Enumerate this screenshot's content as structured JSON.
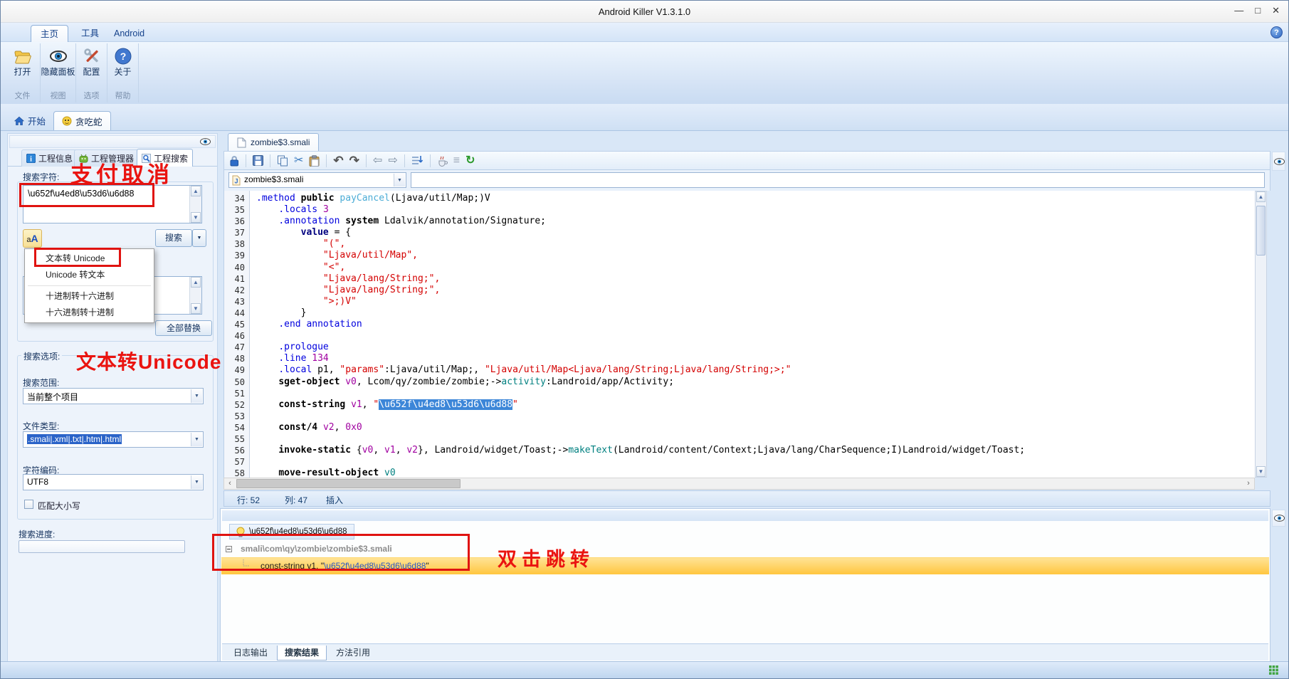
{
  "window": {
    "title": "Android Killer V1.3.1.0",
    "controls": {
      "minimize": "—",
      "maximize": "□",
      "close": "✕"
    },
    "help_label": "?"
  },
  "icons": {
    "dropdown": "▼",
    "up": "▲",
    "down": "▼",
    "left": "‹",
    "right": "›",
    "cut": "✂",
    "undo": "↶",
    "redo": "↷",
    "back": "⇦",
    "forward": "⇨",
    "lines": "≡",
    "refresh": "↻"
  },
  "ribbon": {
    "tabs": [
      {
        "label": "主页"
      },
      {
        "label": "工具"
      },
      {
        "label": "Android"
      }
    ],
    "buttons": [
      {
        "label": "打开",
        "group": "文件",
        "icon": "open-folder-icon"
      },
      {
        "label": "隐藏面板",
        "group": "视图",
        "icon": "eye-icon"
      },
      {
        "label": "配置",
        "group": "选项",
        "icon": "tools-icon"
      },
      {
        "label": "关于",
        "group": "帮助",
        "icon": "help-icon"
      }
    ]
  },
  "doc_tabs": [
    {
      "label": "开始"
    },
    {
      "label": "贪吃蛇"
    }
  ],
  "left_panel": {
    "tabs": [
      {
        "label": "工程信息"
      },
      {
        "label": "工程管理器"
      },
      {
        "label": "工程搜索"
      }
    ],
    "search_label": "搜索字符:",
    "search_value": "\\u652f\\u4ed8\\u53d6\\u6d88",
    "convert_icon": {
      "small": "a",
      "big": "A"
    },
    "search_button": "搜索",
    "menu": {
      "items": [
        "文本转 Unicode",
        "Unicode 转文本",
        "十进制转十六进制",
        "十六进制转十进制"
      ]
    },
    "replace_all_button": "全部替换",
    "options_label": "搜索选项:",
    "scope_label": "搜索范围:",
    "scope_value": "当前整个项目",
    "filetype_label": "文件类型:",
    "filetype_value": ".smali|.xml|.txt|.htm|.html",
    "encoding_label": "字符编码:",
    "encoding_value": "UTF8",
    "match_case_label": "匹配大小写",
    "progress_label": "搜索进度:"
  },
  "annotations": {
    "pay_cancel": "支付取消",
    "text_to_unicode": "文本转Unicode",
    "double_click_jump": "双击跳转"
  },
  "editor": {
    "tab_label": "zombie$3.smali",
    "file_combo_value": "zombie$3.smali",
    "status": {
      "line": "行: 52",
      "column": "列: 47",
      "mode": "插入"
    },
    "code_lines": [
      {
        "n": 34,
        "t": [
          [
            "kw",
            ".method "
          ],
          [
            "b",
            "public "
          ],
          [
            "mn",
            "payCancel"
          ],
          [
            "pl",
            "(Ljava/util/Map;)V"
          ]
        ]
      },
      {
        "n": 35,
        "t": [
          [
            "pl",
            "    "
          ],
          [
            "kw",
            ".locals "
          ],
          [
            "num",
            "3"
          ]
        ]
      },
      {
        "n": 36,
        "t": [
          [
            "pl",
            "    "
          ],
          [
            "kw",
            ".annotation "
          ],
          [
            "b",
            "system "
          ],
          [
            "pl",
            "Ldalvik/annotation/Signature;"
          ]
        ]
      },
      {
        "n": 37,
        "t": [
          [
            "pl",
            "        "
          ],
          [
            "bn",
            "value"
          ],
          [
            "pl",
            " = {"
          ]
        ]
      },
      {
        "n": 38,
        "t": [
          [
            "pl",
            "            "
          ],
          [
            "str",
            "\"(\","
          ]
        ]
      },
      {
        "n": 39,
        "t": [
          [
            "pl",
            "            "
          ],
          [
            "str",
            "\"Ljava/util/Map\","
          ]
        ]
      },
      {
        "n": 40,
        "t": [
          [
            "pl",
            "            "
          ],
          [
            "str",
            "\"<\","
          ]
        ]
      },
      {
        "n": 41,
        "t": [
          [
            "pl",
            "            "
          ],
          [
            "str",
            "\"Ljava/lang/String;\","
          ]
        ]
      },
      {
        "n": 42,
        "t": [
          [
            "pl",
            "            "
          ],
          [
            "str",
            "\"Ljava/lang/String;\","
          ]
        ]
      },
      {
        "n": 43,
        "t": [
          [
            "pl",
            "            "
          ],
          [
            "str",
            "\">;)V\""
          ]
        ]
      },
      {
        "n": 44,
        "t": [
          [
            "pl",
            "        }"
          ]
        ]
      },
      {
        "n": 45,
        "t": [
          [
            "pl",
            "    "
          ],
          [
            "kw",
            ".end annotation"
          ]
        ]
      },
      {
        "n": 46,
        "t": []
      },
      {
        "n": 47,
        "t": [
          [
            "pl",
            "    "
          ],
          [
            "kw",
            ".prologue"
          ]
        ]
      },
      {
        "n": 48,
        "t": [
          [
            "pl",
            "    "
          ],
          [
            "kw",
            ".line "
          ],
          [
            "num",
            "134"
          ]
        ]
      },
      {
        "n": 49,
        "t": [
          [
            "pl",
            "    "
          ],
          [
            "kw",
            ".local "
          ],
          [
            "pl",
            "p1, "
          ],
          [
            "str",
            "\"params\""
          ],
          [
            "pl",
            ":Ljava/util/Map;, "
          ],
          [
            "str",
            "\"Ljava/util/Map<Ljava/lang/String;Ljava/lang/String;>;\""
          ]
        ]
      },
      {
        "n": 50,
        "t": [
          [
            "pl",
            "    "
          ],
          [
            "b",
            "sget-object "
          ],
          [
            "reg",
            "v0"
          ],
          [
            "pl",
            ", Lcom/qy/zombie/zombie;->"
          ],
          [
            "fn",
            "activity"
          ],
          [
            "pl",
            ":Landroid/app/Activity;"
          ]
        ]
      },
      {
        "n": 51,
        "t": []
      },
      {
        "n": 52,
        "t": [
          [
            "pl",
            "    "
          ],
          [
            "b",
            "const-string "
          ],
          [
            "reg",
            "v1"
          ],
          [
            "pl",
            ", "
          ],
          [
            "str",
            "\""
          ],
          [
            "sel",
            "\\u652f\\u4ed8\\u53d6\\u6d88"
          ],
          [
            "str",
            "\""
          ]
        ]
      },
      {
        "n": 53,
        "t": []
      },
      {
        "n": 54,
        "t": [
          [
            "pl",
            "    "
          ],
          [
            "b",
            "const/4 "
          ],
          [
            "reg",
            "v2"
          ],
          [
            "pl",
            ", "
          ],
          [
            "num",
            "0x0"
          ]
        ]
      },
      {
        "n": 55,
        "t": []
      },
      {
        "n": 56,
        "t": [
          [
            "pl",
            "    "
          ],
          [
            "b",
            "invoke-static "
          ],
          [
            "pl",
            "{"
          ],
          [
            "reg",
            "v0"
          ],
          [
            "pl",
            ", "
          ],
          [
            "reg",
            "v1"
          ],
          [
            "pl",
            ", "
          ],
          [
            "reg",
            "v2"
          ],
          [
            "pl",
            "}, Landroid/widget/Toast;->"
          ],
          [
            "fn",
            "makeText"
          ],
          [
            "pl",
            "(Landroid/content/Context;Ljava/lang/CharSequence;I)Landroid/widget/Toast;"
          ]
        ]
      },
      {
        "n": 57,
        "t": []
      },
      {
        "n": 58,
        "t": [
          [
            "pl",
            "    "
          ],
          [
            "b",
            "move-result-object "
          ],
          [
            "fn",
            "v0"
          ]
        ]
      }
    ]
  },
  "results_panel": {
    "query_node": "\\u652f\\u4ed8\\u53d6\\u6d88",
    "file_node": "smali\\com\\qy\\zombie\\zombie$3.smali",
    "match_node": {
      "prefix": "const-string v1, \"",
      "unicode": "\\u652f\\u4ed8\\u53d6\\u6d88",
      "suffix": "\""
    },
    "tabs": [
      "日志输出",
      "搜索结果",
      "方法引用"
    ]
  }
}
